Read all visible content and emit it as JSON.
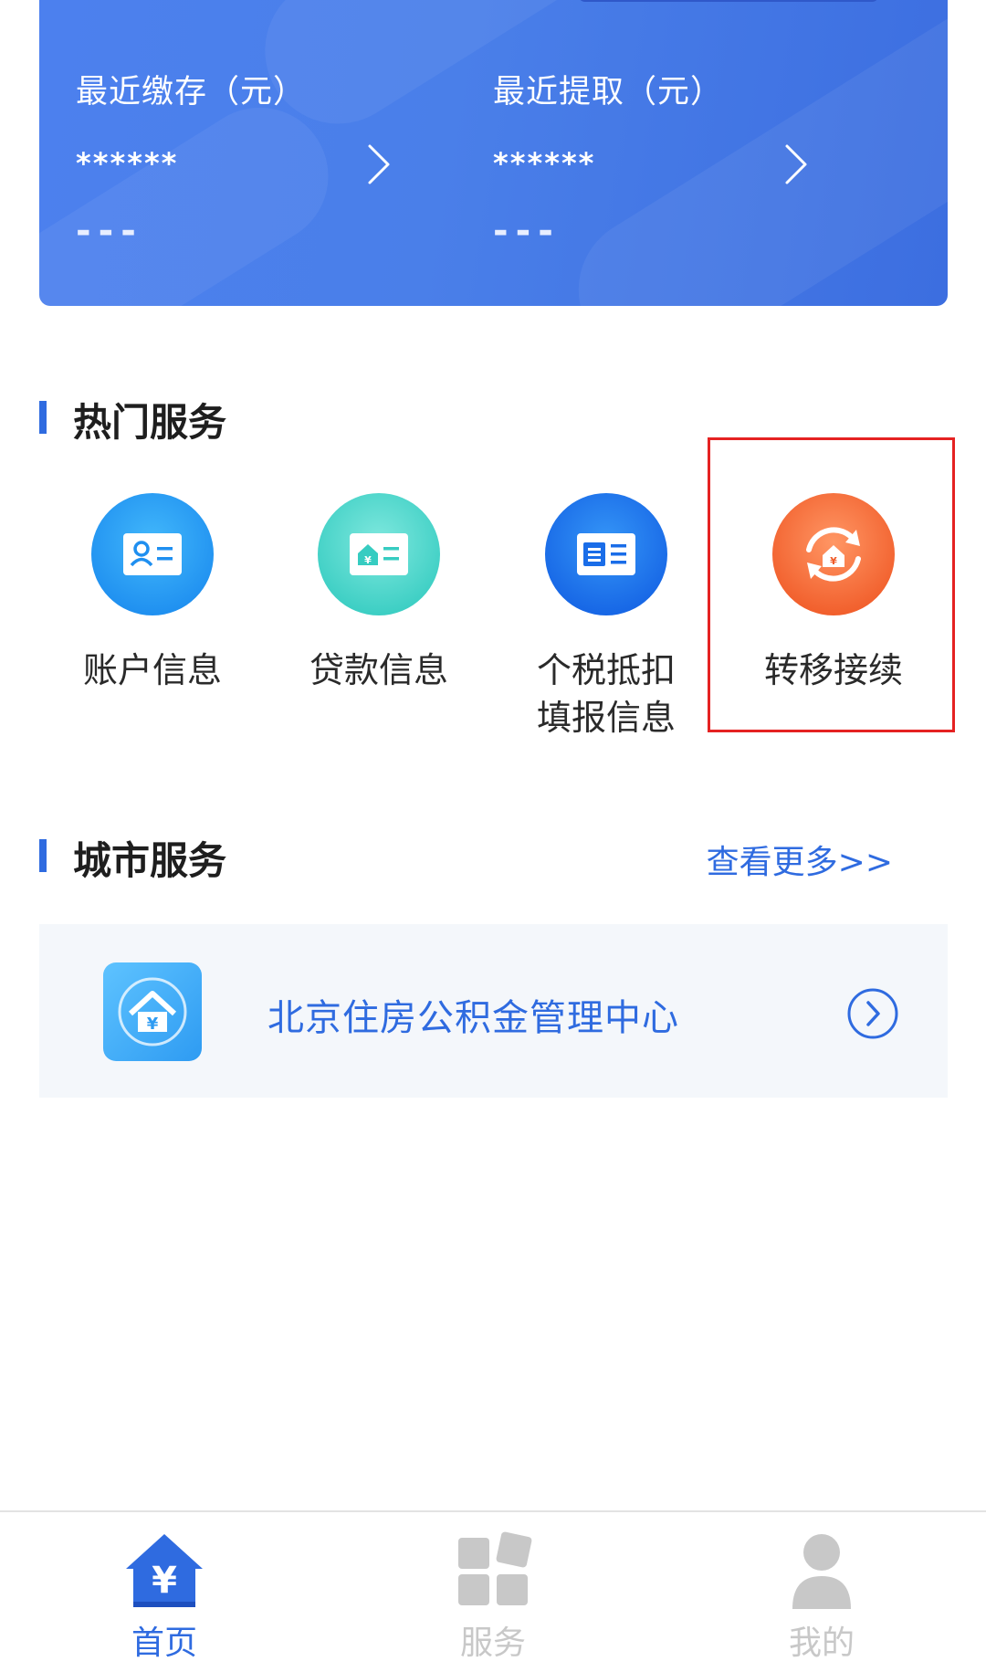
{
  "balance_card": {
    "stats": [
      {
        "label": "最近缴存（元）",
        "value": "******",
        "sub": "---"
      },
      {
        "label": "最近提取（元）",
        "value": "******",
        "sub": "---"
      }
    ]
  },
  "hot_services": {
    "title": "热门服务",
    "items": [
      {
        "label": "账户信息",
        "icon": "id-card-icon",
        "color_from": "#3bb0f8",
        "color_to": "#1f8ff0"
      },
      {
        "label": "贷款信息",
        "icon": "house-card-icon",
        "color_from": "#6fe3d8",
        "color_to": "#39cfc4"
      },
      {
        "label": "个税抵扣\n填报信息",
        "icon": "tax-card-icon",
        "color_from": "#2f8cf6",
        "color_to": "#1565e6"
      },
      {
        "label": "转移接续",
        "icon": "transfer-icon",
        "color_from": "#ff8c55",
        "color_to": "#f2622d"
      }
    ]
  },
  "city_services": {
    "title": "城市服务",
    "more_label": "查看更多>>",
    "card": {
      "name": "北京住房公积金管理中心",
      "icon": "housing-fund-logo-icon"
    }
  },
  "bottom_nav": {
    "items": [
      {
        "label": "首页",
        "icon": "home-yuan-icon",
        "active": true
      },
      {
        "label": "服务",
        "icon": "grid-icon",
        "active": false
      },
      {
        "label": "我的",
        "icon": "user-icon",
        "active": false
      }
    ],
    "active_color": "#2f6be0",
    "inactive_color": "#c8c8c8"
  }
}
